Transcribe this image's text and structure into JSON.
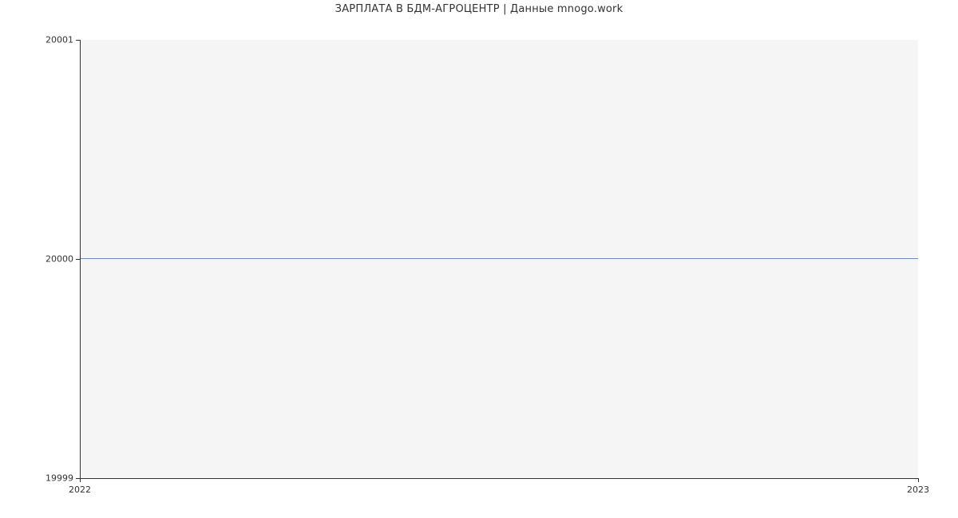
{
  "chart_data": {
    "type": "line",
    "title": "ЗАРПЛАТА В  БДМ-АГРОЦЕНТР | Данные mnogo.work",
    "xlabel": "",
    "ylabel": "",
    "x": [
      2022,
      2023
    ],
    "values": [
      20000,
      20000
    ],
    "xlim": [
      2022,
      2023
    ],
    "ylim": [
      19999,
      20001
    ],
    "x_ticks": [
      "2022",
      "2023"
    ],
    "y_ticks": [
      "19999",
      "20000",
      "20001"
    ],
    "line_color": "#5b8def",
    "plot_bg": "#f5f5f5"
  }
}
